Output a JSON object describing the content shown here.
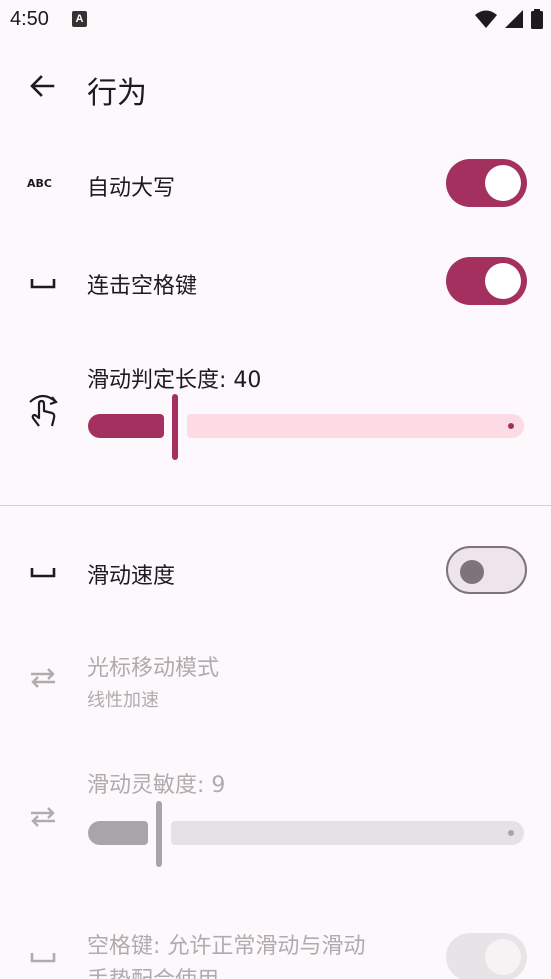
{
  "status_bar": {
    "time": "4:50",
    "app_icon_letter": "A"
  },
  "app_bar": {
    "title": "行为"
  },
  "settings": {
    "auto_capitalize": {
      "label": "自动大写",
      "icon": "abc-icon",
      "enabled": true
    },
    "double_space": {
      "label": "连击空格键",
      "icon": "space-bar-icon",
      "enabled": true
    },
    "swipe_threshold": {
      "label": "滑动判定长度: 40",
      "icon": "swipe-gesture-icon",
      "value": 40,
      "fraction": 0.2
    },
    "swipe_speed": {
      "label": "滑动速度",
      "icon": "space-bar-icon",
      "enabled": false
    },
    "cursor_mode": {
      "label": "光标移动模式",
      "sub": "线性加速",
      "icon": "swap-horiz-icon"
    },
    "swipe_sensitivity": {
      "label": "滑动灵敏度: 9",
      "icon": "swap-horiz-icon",
      "value": 9,
      "fraction": 0.16
    },
    "space_swipe": {
      "label": "空格键: 允许正常滑动与滑动",
      "label2": "手势配合使用",
      "icon": "space-bar-icon",
      "enabled": true
    }
  },
  "colors": {
    "accent": "#a3305f",
    "track_inactive": "#fcdbe4",
    "disabled": "#a9a4a7"
  }
}
